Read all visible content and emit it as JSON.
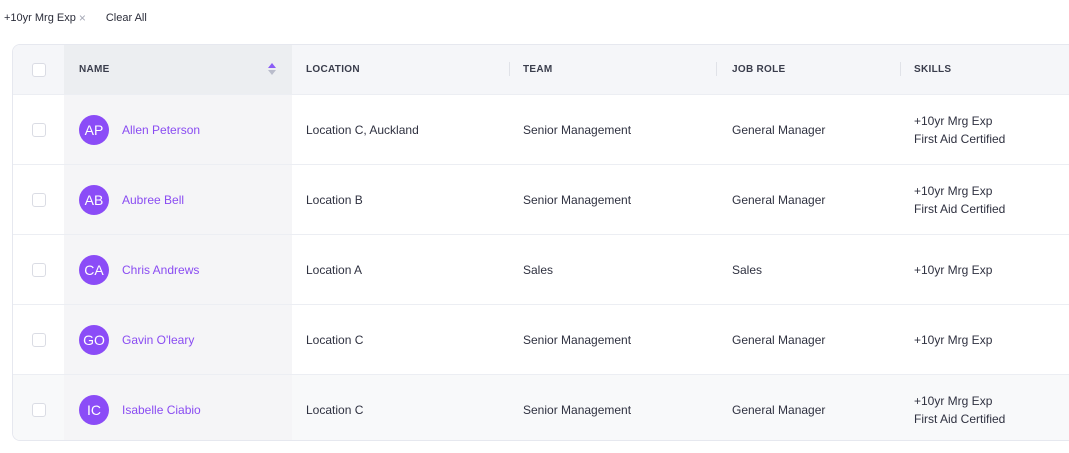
{
  "filters": {
    "active": [
      {
        "label": "+10yr Mrg Exp",
        "close_icon": "×"
      }
    ],
    "clear_all_label": "Clear All"
  },
  "table": {
    "columns": {
      "name": "NAME",
      "location": "LOCATION",
      "team": "TEAM",
      "job_role": "JOB ROLE",
      "skills": "SKILLS"
    },
    "sort": {
      "column": "name",
      "direction": "asc",
      "icon": "sort-arrows-icon",
      "active_color": "#8a5cf6"
    },
    "rows": [
      {
        "initials": "AP",
        "name": "Allen Peterson",
        "location": "Location C, Auckland",
        "team": "Senior Management",
        "job_role": "General Manager",
        "skills": [
          "+10yr Mrg Exp",
          "First Aid Certified"
        ]
      },
      {
        "initials": "AB",
        "name": "Aubree Bell",
        "location": "Location B",
        "team": "Senior Management",
        "job_role": "General Manager",
        "skills": [
          "+10yr Mrg Exp",
          "First Aid Certified"
        ]
      },
      {
        "initials": "CA",
        "name": "Chris Andrews",
        "location": "Location A",
        "team": "Sales",
        "job_role": "Sales",
        "skills": [
          "+10yr Mrg Exp"
        ]
      },
      {
        "initials": "GO",
        "name": "Gavin O'leary",
        "location": "Location C",
        "team": "Senior Management",
        "job_role": "General Manager",
        "skills": [
          "+10yr Mrg Exp"
        ]
      },
      {
        "initials": "IC",
        "name": "Isabelle Ciabio",
        "location": "Location C",
        "team": "Senior Management",
        "job_role": "General Manager",
        "skills": [
          "+10yr Mrg Exp",
          "First Aid Certified"
        ]
      }
    ]
  },
  "colors": {
    "accent": "#8b4cf7",
    "link": "#8a4cf2"
  }
}
